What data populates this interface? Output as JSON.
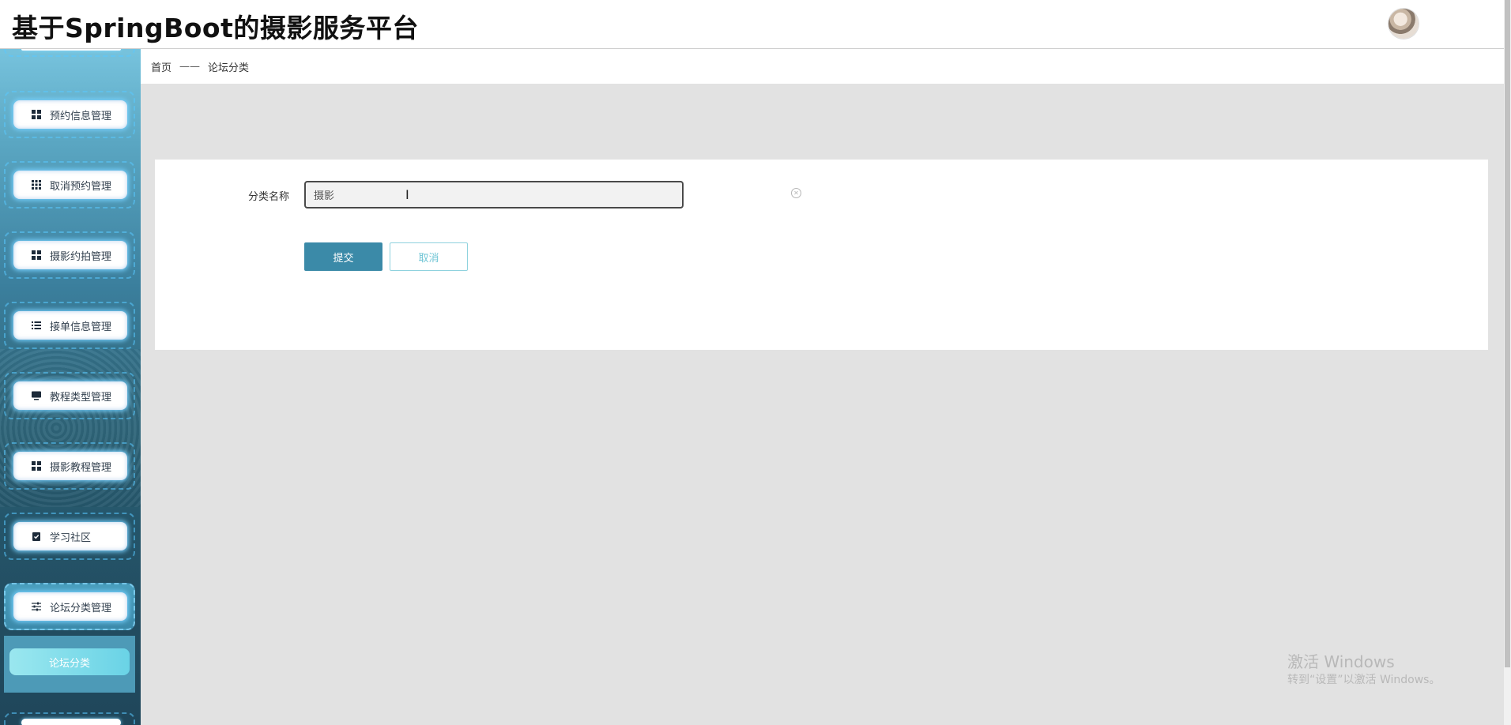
{
  "header": {
    "title": "基于SpringBoot的摄影服务平台"
  },
  "sidebar": {
    "items": [
      {
        "label": "预约信息管理",
        "icon": "grid-icon"
      },
      {
        "label": "取消预约管理",
        "icon": "apps-icon"
      },
      {
        "label": "摄影约拍管理",
        "icon": "grid-icon"
      },
      {
        "label": "接单信息管理",
        "icon": "list-icon"
      },
      {
        "label": "教程类型管理",
        "icon": "monitor-icon"
      },
      {
        "label": "摄影教程管理",
        "icon": "grid-icon"
      },
      {
        "label": "学习社区",
        "icon": "clipboard-check-icon"
      },
      {
        "label": "论坛分类管理",
        "icon": "sliders-icon"
      }
    ],
    "sub_item": "论坛分类"
  },
  "breadcrumb": {
    "home": "首页",
    "separator": "——",
    "current": "论坛分类"
  },
  "form": {
    "label": "分类名称",
    "value": "摄影",
    "submit": "提交",
    "cancel": "取消"
  },
  "watermark": {
    "line1": "激活 Windows",
    "line2": "转到“设置”以激活 Windows。"
  },
  "colors": {
    "primary": "#3b8aa8",
    "sub_active": "#6ad3e6"
  }
}
